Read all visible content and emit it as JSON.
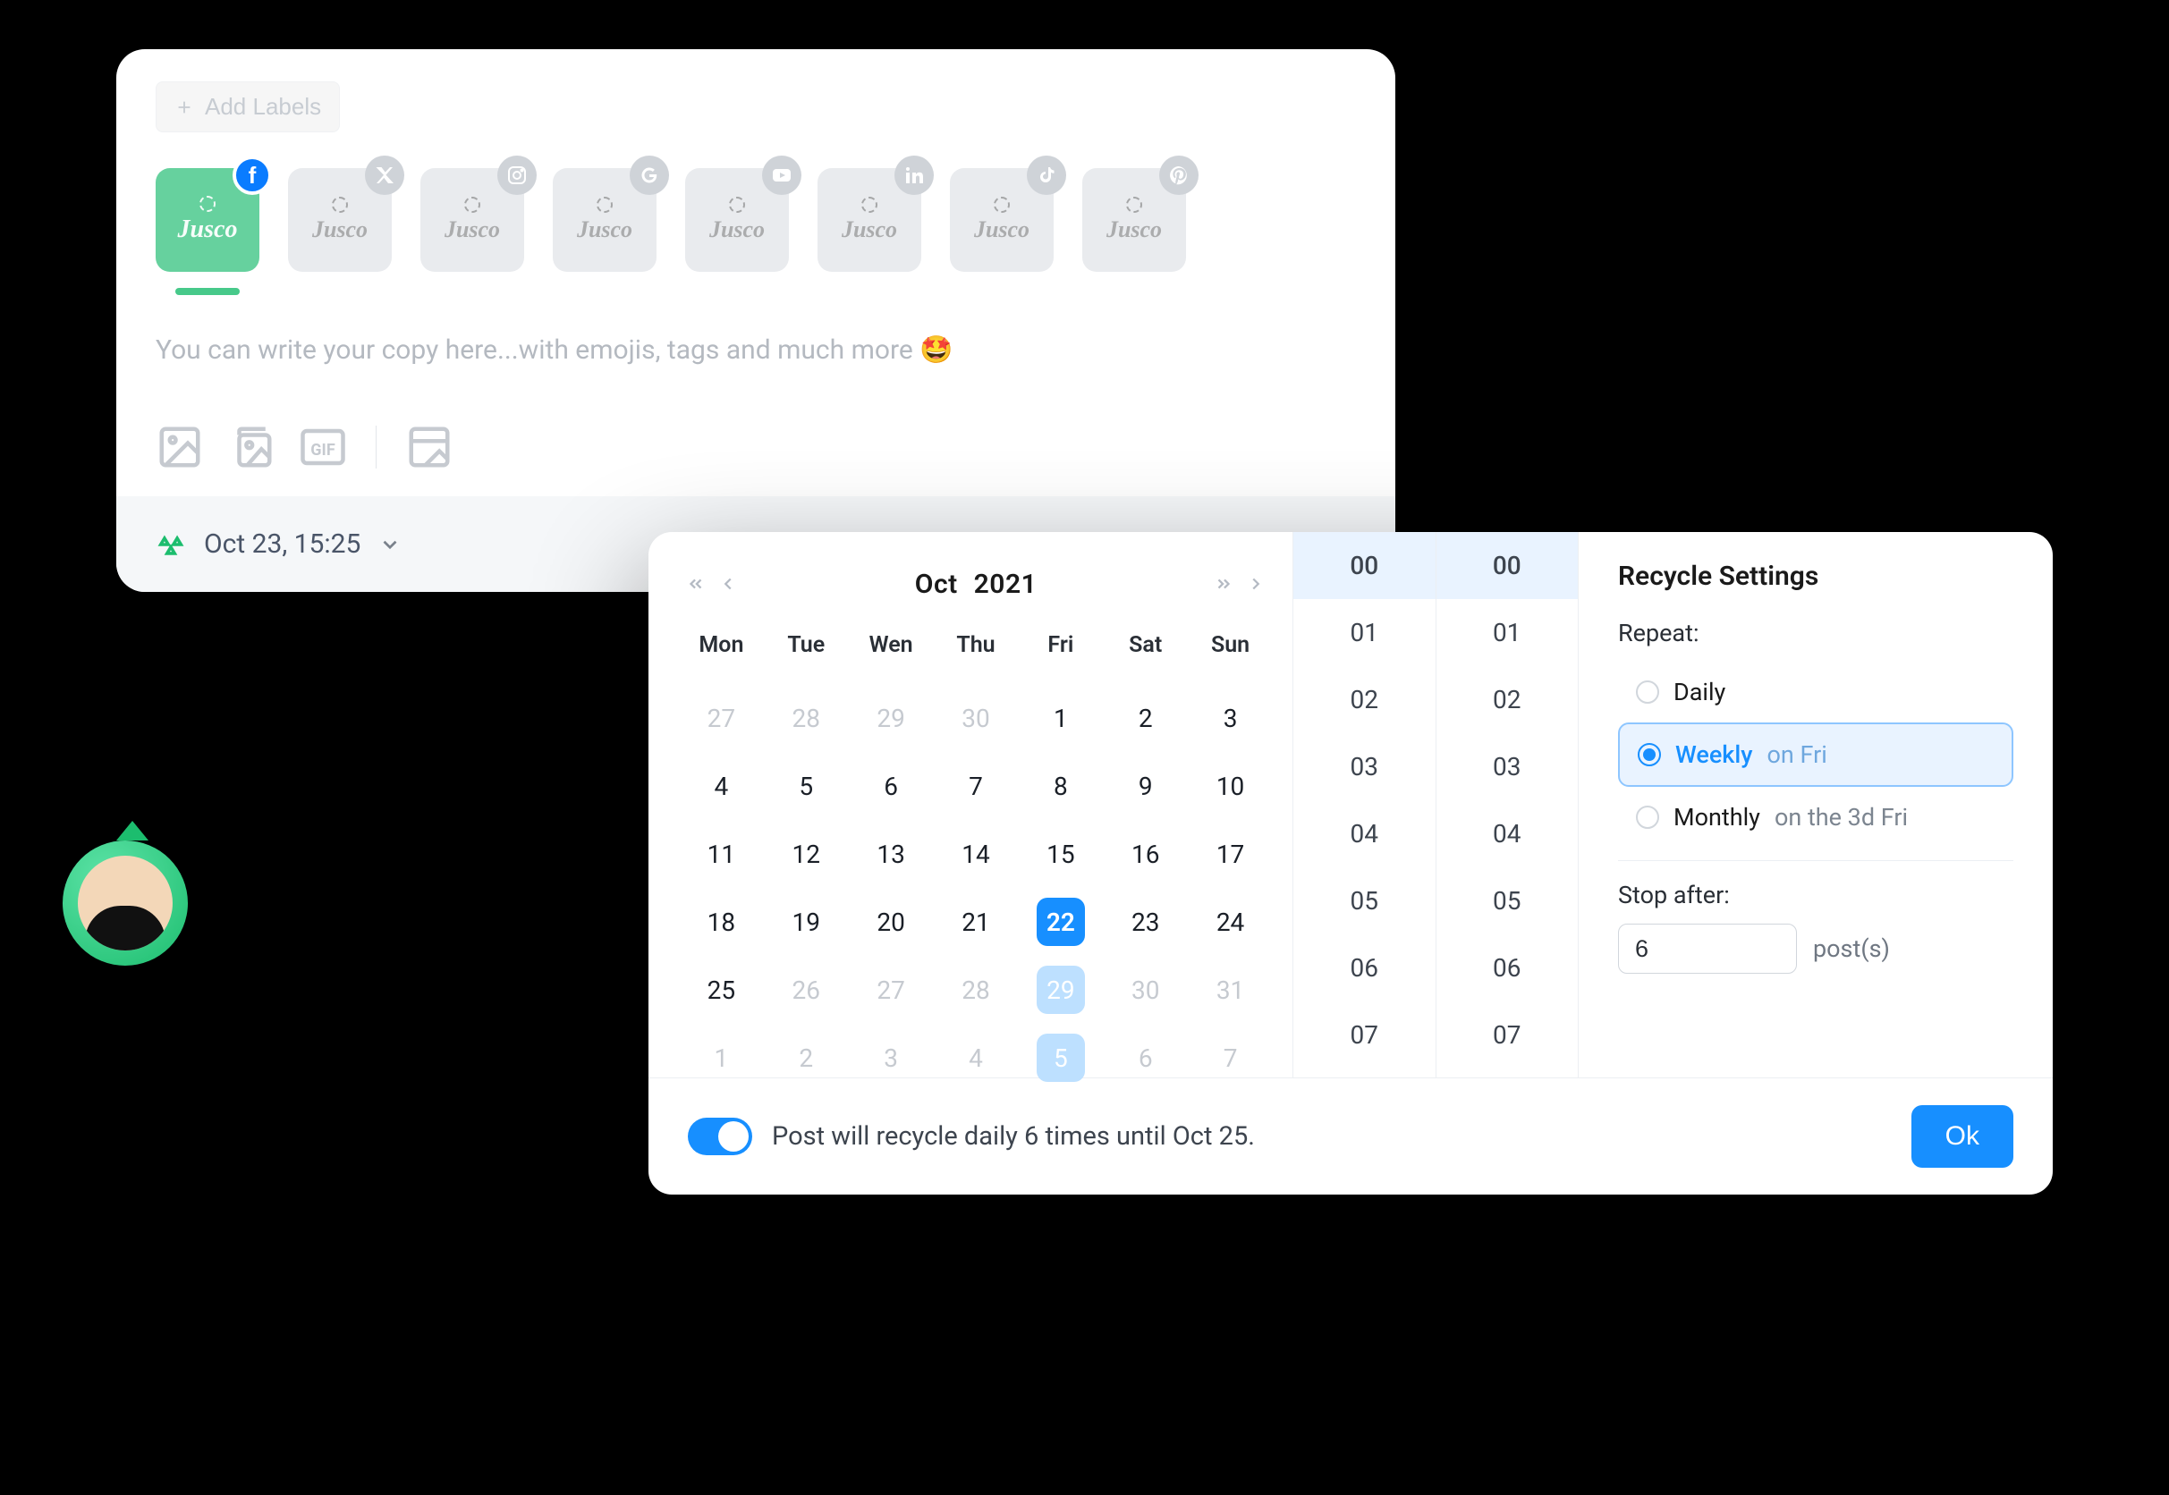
{
  "composer": {
    "add_labels": "Add Labels",
    "accounts": [
      {
        "name": "facebook",
        "brand": "Jusco",
        "active": true
      },
      {
        "name": "x",
        "brand": "Jusco",
        "active": false
      },
      {
        "name": "instagram",
        "brand": "Jusco",
        "active": false
      },
      {
        "name": "google",
        "brand": "Jusco",
        "active": false
      },
      {
        "name": "youtube",
        "brand": "Jusco",
        "active": false
      },
      {
        "name": "linkedin",
        "brand": "Jusco",
        "active": false
      },
      {
        "name": "tiktok",
        "brand": "Jusco",
        "active": false
      },
      {
        "name": "pinterest",
        "brand": "Jusco",
        "active": false
      }
    ],
    "placeholder": "You can write your copy here...with emojis, tags and much more 🤩",
    "schedule_label": "Oct 23, 15:25"
  },
  "scheduler": {
    "month": "Oct",
    "year": "2021",
    "dow": [
      "Mon",
      "Tue",
      "Wen",
      "Thu",
      "Fri",
      "Sat",
      "Sun"
    ],
    "grid": [
      {
        "d": 27,
        "out": true
      },
      {
        "d": 28,
        "out": true
      },
      {
        "d": 29,
        "out": true
      },
      {
        "d": 30,
        "out": true
      },
      {
        "d": 1
      },
      {
        "d": 2
      },
      {
        "d": 3
      },
      {
        "d": 4
      },
      {
        "d": 5
      },
      {
        "d": 6
      },
      {
        "d": 7
      },
      {
        "d": 8
      },
      {
        "d": 9
      },
      {
        "d": 10
      },
      {
        "d": 11
      },
      {
        "d": 12
      },
      {
        "d": 13
      },
      {
        "d": 14
      },
      {
        "d": 15
      },
      {
        "d": 16
      },
      {
        "d": 17
      },
      {
        "d": 18
      },
      {
        "d": 19
      },
      {
        "d": 20
      },
      {
        "d": 21
      },
      {
        "d": 22,
        "sel": true
      },
      {
        "d": 23
      },
      {
        "d": 24
      },
      {
        "d": 25
      },
      {
        "d": 26,
        "out": true
      },
      {
        "d": 27,
        "out": true
      },
      {
        "d": 28,
        "out": true
      },
      {
        "d": 29,
        "hl": true
      },
      {
        "d": 30,
        "out": true
      },
      {
        "d": 31,
        "out": true
      },
      {
        "d": 1,
        "out": true
      },
      {
        "d": 2,
        "out": true
      },
      {
        "d": 3,
        "out": true
      },
      {
        "d": 4,
        "out": true
      },
      {
        "d": 5,
        "hl": true
      },
      {
        "d": 6,
        "out": true
      },
      {
        "d": 7,
        "out": true
      }
    ],
    "hours": [
      "00",
      "01",
      "02",
      "03",
      "04",
      "05",
      "06",
      "07"
    ],
    "minutes": [
      "00",
      "01",
      "02",
      "03",
      "04",
      "05",
      "06",
      "07"
    ],
    "hour_selected": "00",
    "minute_selected": "00",
    "recycle": {
      "title": "Recycle Settings",
      "repeat_label": "Repeat:",
      "options": [
        {
          "label": "Daily",
          "suffix": "",
          "checked": false
        },
        {
          "label": "Weekly",
          "suffix": "on Fri",
          "checked": true
        },
        {
          "label": "Monthly",
          "suffix": "on the 3d Fri",
          "checked": false
        }
      ],
      "stop_label": "Stop after:",
      "stop_value": "6",
      "stop_unit": "post(s)"
    },
    "footer_text": "Post will recycle daily 6 times until Oct 25.",
    "ok": "Ok"
  }
}
